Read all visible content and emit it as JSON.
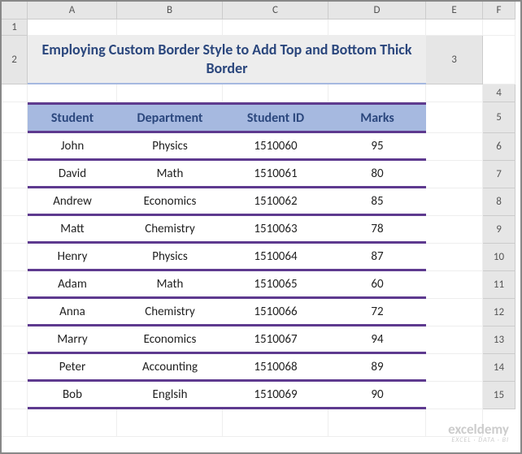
{
  "columns": [
    "A",
    "B",
    "C",
    "D",
    "E",
    "F"
  ],
  "rows": [
    "1",
    "2",
    "3",
    "4",
    "5",
    "6",
    "7",
    "8",
    "9",
    "10",
    "11",
    "12",
    "13",
    "14",
    "15"
  ],
  "title": "Employing Custom Border Style to Add Top and Bottom Thick Border",
  "headers": {
    "student": "Student",
    "department": "Department",
    "student_id": "Student ID",
    "marks": "Marks"
  },
  "students": [
    {
      "name": "John",
      "dept": "Physics",
      "id": "1510060",
      "marks": "95"
    },
    {
      "name": "David",
      "dept": "Math",
      "id": "1510061",
      "marks": "80"
    },
    {
      "name": "Andrew",
      "dept": "Economics",
      "id": "1510062",
      "marks": "85"
    },
    {
      "name": "Matt",
      "dept": "Chemistry",
      "id": "1510063",
      "marks": "78"
    },
    {
      "name": "Henry",
      "dept": "Physics",
      "id": "1510064",
      "marks": "87"
    },
    {
      "name": "Adam",
      "dept": "Math",
      "id": "1510065",
      "marks": "60"
    },
    {
      "name": "Anna",
      "dept": "Chemistry",
      "id": "1510066",
      "marks": "72"
    },
    {
      "name": "Marry",
      "dept": "Economics",
      "id": "1510067",
      "marks": "94"
    },
    {
      "name": "Peter",
      "dept": "Accounting",
      "id": "1510068",
      "marks": "89"
    },
    {
      "name": "Bob",
      "dept": "Englsih",
      "id": "1510069",
      "marks": "90"
    }
  ],
  "watermark": {
    "line1": "exceldemy",
    "line2": "EXCEL · DATA · BI"
  },
  "chart_data": {
    "type": "table",
    "title": "Employing Custom Border Style to Add Top and Bottom Thick Border",
    "columns": [
      "Student",
      "Department",
      "Student ID",
      "Marks"
    ],
    "rows": [
      [
        "John",
        "Physics",
        1510060,
        95
      ],
      [
        "David",
        "Math",
        1510061,
        80
      ],
      [
        "Andrew",
        "Economics",
        1510062,
        85
      ],
      [
        "Matt",
        "Chemistry",
        1510063,
        78
      ],
      [
        "Henry",
        "Physics",
        1510064,
        87
      ],
      [
        "Adam",
        "Math",
        1510065,
        60
      ],
      [
        "Anna",
        "Chemistry",
        1510066,
        72
      ],
      [
        "Marry",
        "Economics",
        1510067,
        94
      ],
      [
        "Peter",
        "Accounting",
        1510068,
        89
      ],
      [
        "Bob",
        "Englsih",
        1510069,
        90
      ]
    ]
  }
}
